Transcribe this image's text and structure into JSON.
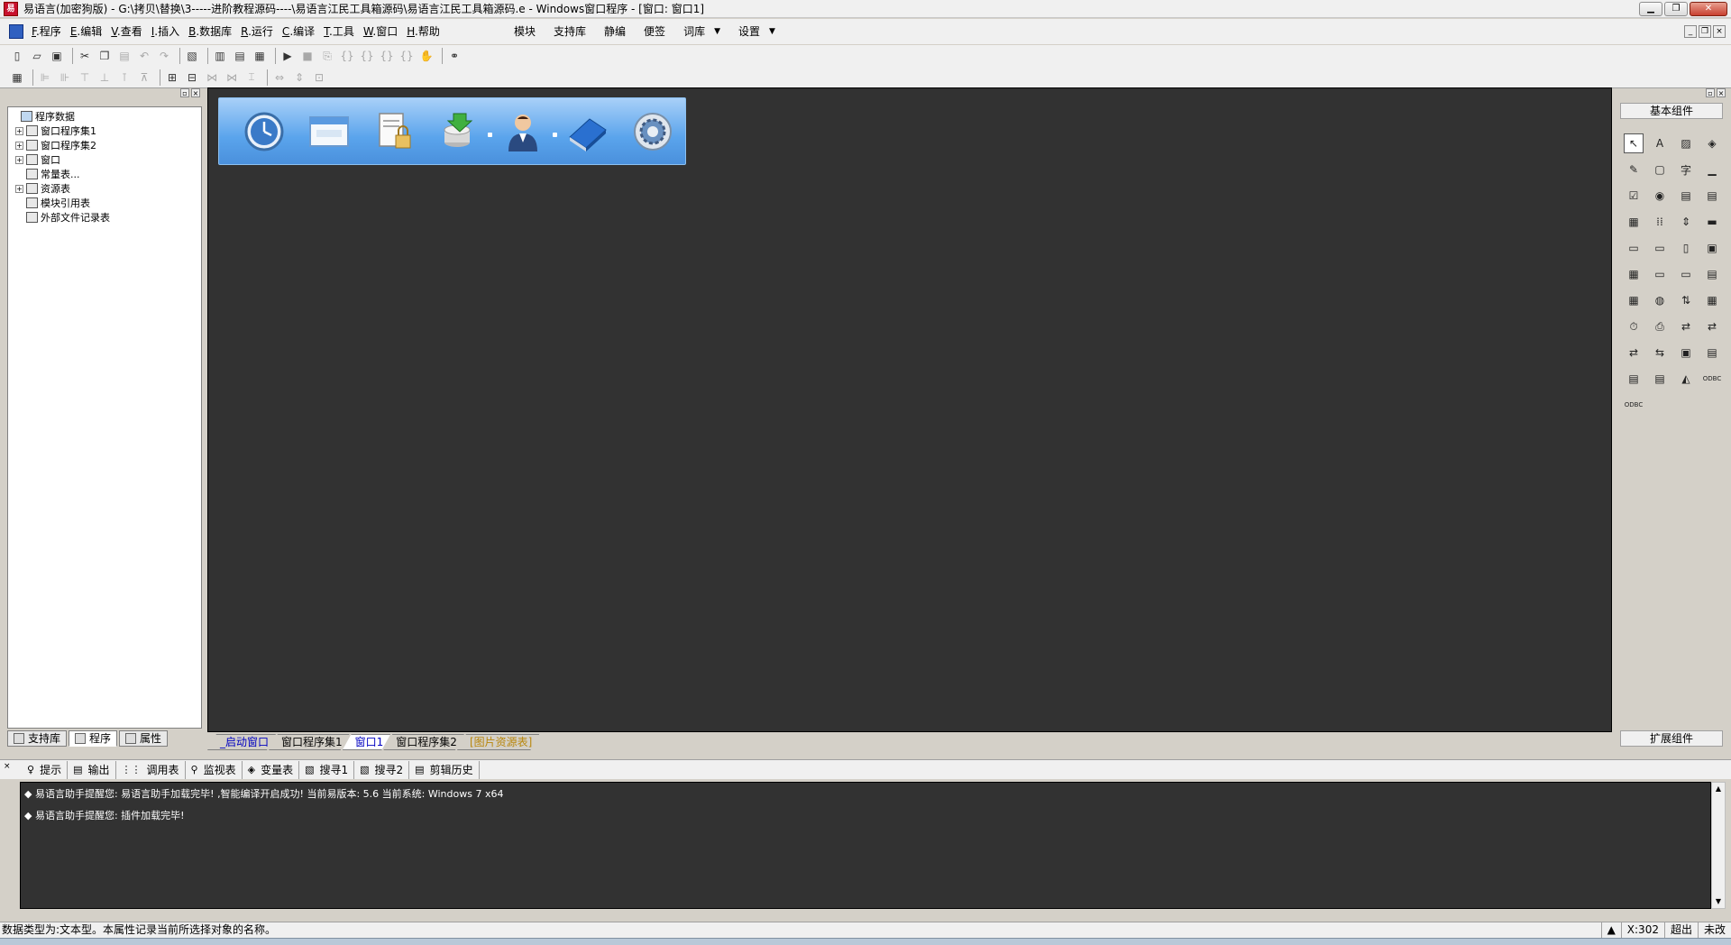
{
  "window": {
    "title": "易语言(加密狗版) - G:\\拷贝\\替换\\3-----进阶教程源码----\\易语言江民工具箱源码\\易语言江民工具箱源码.e - Windows窗口程序 - [窗口: 窗口1]",
    "app_icon": "e-logo-icon",
    "minimize": "0",
    "restore": "▫",
    "close": "×"
  },
  "menu": {
    "items": [
      {
        "accel": "F",
        "label": ".程序"
      },
      {
        "accel": "E",
        "label": ".编辑"
      },
      {
        "accel": "V",
        "label": ".查看"
      },
      {
        "accel": "I",
        "label": ".插入"
      },
      {
        "accel": "B",
        "label": ".数据库"
      },
      {
        "accel": "R",
        "label": ".运行"
      },
      {
        "accel": "C",
        "label": ".编译"
      },
      {
        "accel": "T",
        "label": ".工具"
      },
      {
        "accel": "W",
        "label": ".窗口"
      },
      {
        "accel": "H",
        "label": ".帮助"
      }
    ],
    "extra": [
      "模块",
      "支持库",
      "静编",
      "便签",
      "词库",
      "设置"
    ],
    "dropdown_glyph": "▼",
    "mdi_buttons": [
      "_",
      "▫",
      "×"
    ]
  },
  "left_panel": {
    "tree": [
      {
        "label": "程序数据",
        "level": 0,
        "expander": ""
      },
      {
        "label": "窗口程序集1",
        "level": 1,
        "expander": "+"
      },
      {
        "label": "窗口程序集2",
        "level": 1,
        "expander": "+"
      },
      {
        "label": "窗口",
        "level": 1,
        "expander": "+"
      },
      {
        "label": "常量表...",
        "level": 1,
        "expander": ""
      },
      {
        "label": "资源表",
        "level": 1,
        "expander": "+"
      },
      {
        "label": "模块引用表",
        "level": 1,
        "expander": ""
      },
      {
        "label": "外部文件记录表",
        "level": 1,
        "expander": ""
      }
    ],
    "tabs": [
      "支持库",
      "程序",
      "属性"
    ]
  },
  "design_tabs": [
    "_启动窗口",
    "窗口程序集1",
    "窗口1",
    "窗口程序集2",
    "[图片资源表]"
  ],
  "dock_icons": [
    "clock-icon",
    "browser-window-icon",
    "document-lock-icon",
    "database-download-icon",
    "user-icon",
    "blue-book-icon",
    "gear-icon"
  ],
  "right_panel": {
    "header": "基本组件",
    "footer": "扩展组件",
    "components": [
      "↖",
      "A",
      "▨",
      "◈",
      "✎",
      "▢",
      "字",
      "▁",
      "☑",
      "◉",
      "▤",
      "▤",
      "▦",
      "⁞⁞",
      "⇕",
      "▬",
      "▭",
      "▭",
      "▯",
      "▣",
      "▦",
      "▭",
      "▭",
      "▤",
      "▦",
      "◍",
      "⇅",
      "▦",
      "⏱",
      "⎙",
      "⇄",
      "⇄",
      "⇄",
      "⇆",
      "▣",
      "▤",
      "▤",
      "▤",
      "◭",
      "ODBC",
      "ODBC"
    ]
  },
  "output_tabs": [
    {
      "icon": "lightbulb-icon",
      "glyph": "♀",
      "label": "提示"
    },
    {
      "icon": "output-icon",
      "glyph": "▤",
      "label": "输出"
    },
    {
      "icon": "callstack-icon",
      "glyph": "⋮⋮",
      "label": "调用表"
    },
    {
      "icon": "magnifier-icon",
      "glyph": "⚲",
      "label": "监视表"
    },
    {
      "icon": "variables-icon",
      "glyph": "◈",
      "label": "变量表"
    },
    {
      "icon": "search1-icon",
      "glyph": "▧",
      "label": "搜寻1"
    },
    {
      "icon": "search2-icon",
      "glyph": "▧",
      "label": "搜寻2"
    },
    {
      "icon": "clipboard-icon",
      "glyph": "▤",
      "label": "剪辑历史"
    }
  ],
  "output_lines": [
    "◆ 易语言助手提醒您: 易语言助手加载完毕! ,智能编译开启成功! 当前易版本: 5.6 当前系统: Windows 7 x64",
    "◆ 易语言助手提醒您: 插件加载完毕!"
  ],
  "status": {
    "message": "数据类型为:文本型。本属性记录当前所选择对象的名称。",
    "coord": "X:302",
    "mode": "超出",
    "state": "未改"
  },
  "colors": {
    "design_bg": "#323232",
    "dock_gradient_top": "#a8d0f8",
    "dock_gradient_bottom": "#4a90dc"
  }
}
